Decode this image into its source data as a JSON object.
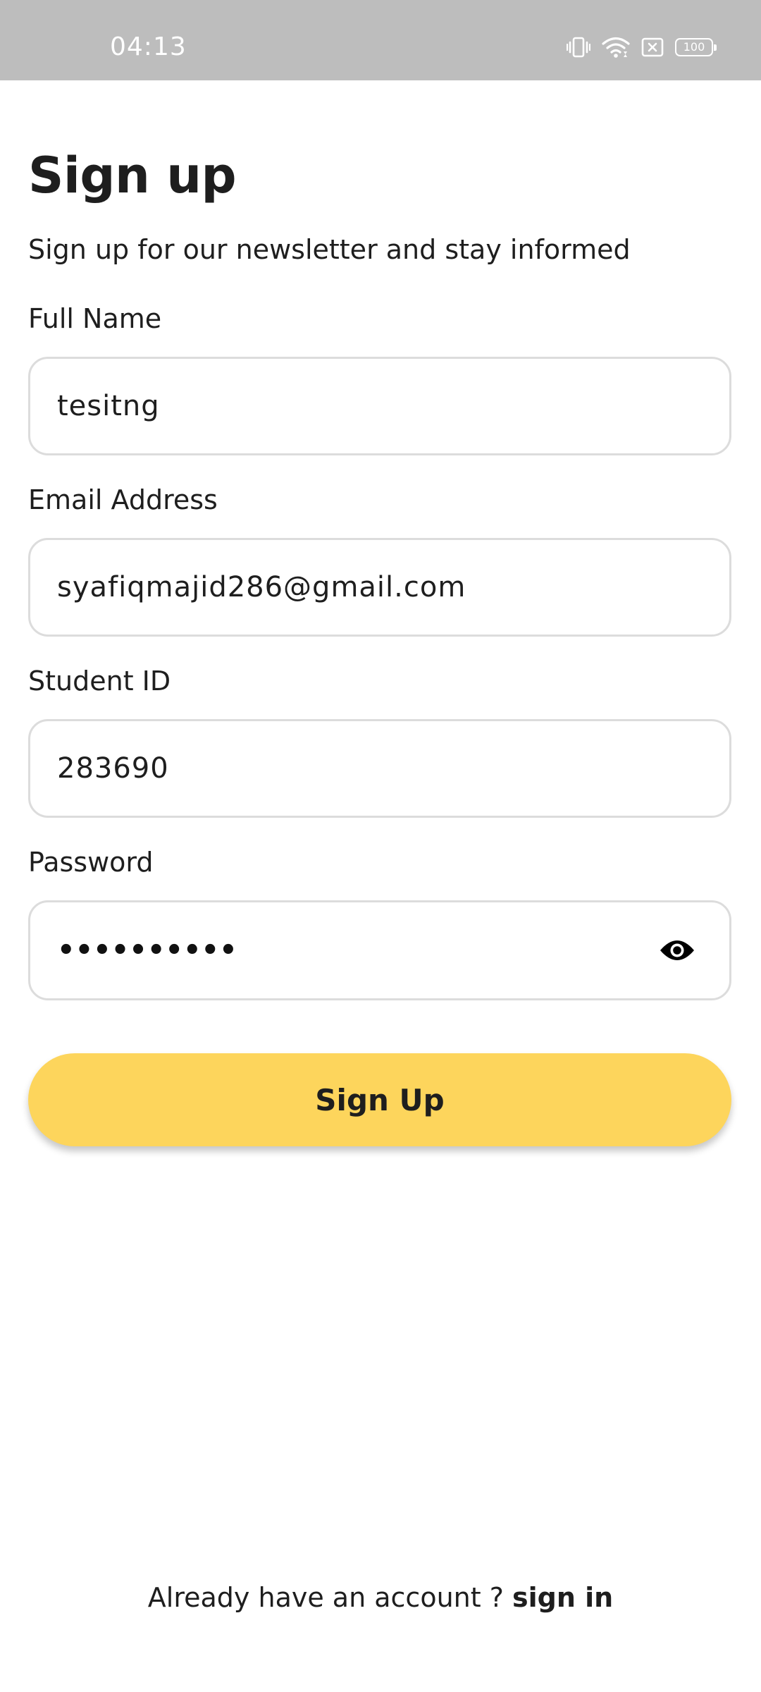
{
  "status_bar": {
    "time": "04:13",
    "battery_level": "100",
    "icons": [
      "vibrate-icon",
      "wifi-icon",
      "no-sim-icon",
      "battery-icon"
    ]
  },
  "header": {
    "title": "Sign up",
    "subtitle": "Sign up for our newsletter and stay informed"
  },
  "form": {
    "full_name": {
      "label": "Full Name",
      "value": "tesitng"
    },
    "email": {
      "label": "Email Address",
      "value": "syafiqmajid286@gmail.com"
    },
    "student_id": {
      "label": "Student ID",
      "value": "283690"
    },
    "password": {
      "label": "Password",
      "masked_value": "••••••••••",
      "toggle_icon": "eye-icon"
    },
    "submit_label": "Sign Up"
  },
  "footer": {
    "prompt": "Already have an account ? ",
    "link_label": "sign in"
  },
  "colors": {
    "accent": "#fdd55c",
    "text": "#1e1e1e",
    "status_bar": "#bdbdbd",
    "field_border": "#dcdcdc"
  }
}
